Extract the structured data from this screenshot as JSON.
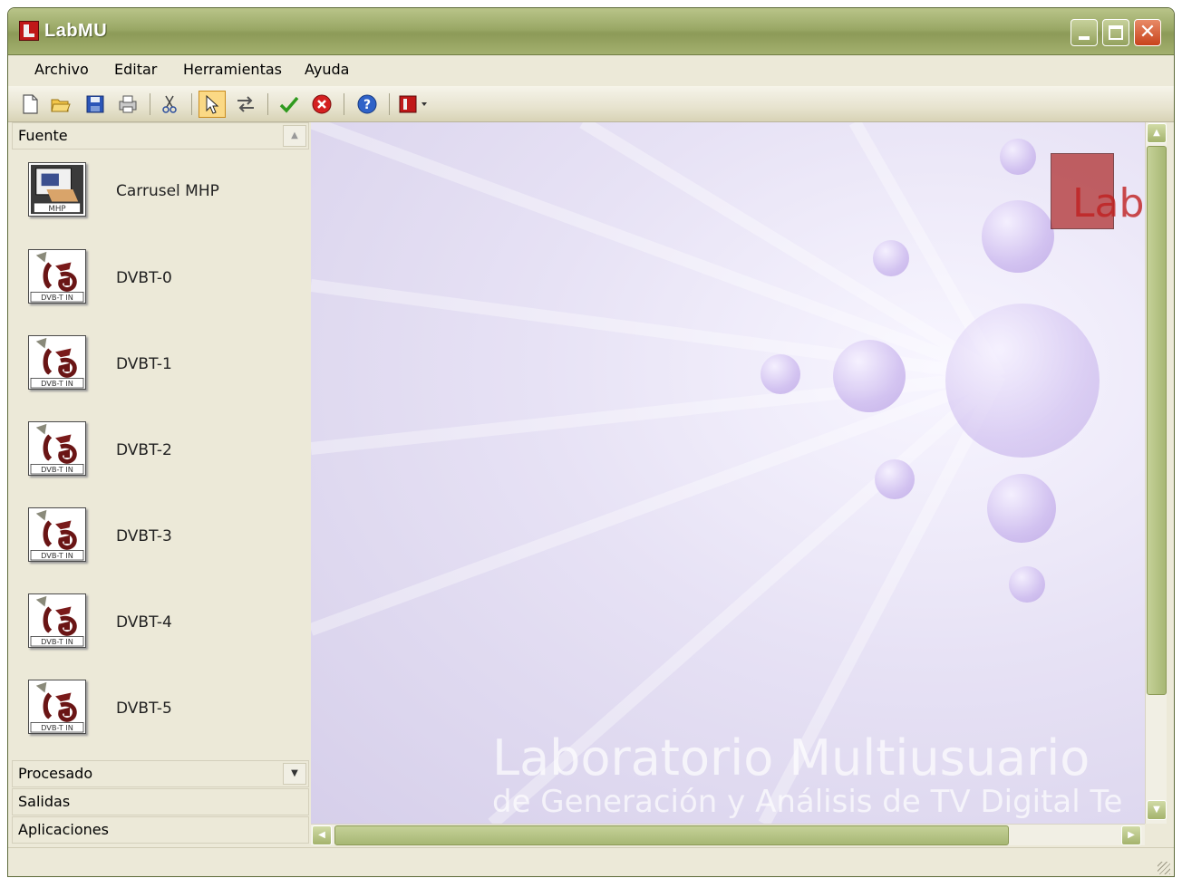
{
  "window": {
    "title": "LabMU",
    "controls": [
      "minimize",
      "maximize",
      "close"
    ]
  },
  "menu": [
    {
      "label": "Archivo"
    },
    {
      "label": "Editar"
    },
    {
      "label": "Herramientas"
    },
    {
      "label": "Ayuda"
    }
  ],
  "toolbar": {
    "icons": [
      "new-file-icon",
      "open-folder-icon",
      "save-icon",
      "print-icon",
      "cut-icon",
      "pointer-icon",
      "swap-arrows-icon",
      "checkmark-icon",
      "stop-icon",
      "help-icon",
      "app-menu-icon"
    ]
  },
  "sidebar": {
    "sections": {
      "fuente": "Fuente",
      "procesado": "Procesado",
      "salidas": "Salidas",
      "aplicaciones": "Aplicaciones"
    },
    "items": [
      {
        "label": "Carrusel MHP",
        "icon_text": "MHP"
      },
      {
        "label": "DVBT-0",
        "icon_text": "DVB-T IN"
      },
      {
        "label": "DVBT-1",
        "icon_text": "DVB-T IN"
      },
      {
        "label": "DVBT-2",
        "icon_text": "DVB-T IN"
      },
      {
        "label": "DVBT-3",
        "icon_text": "DVB-T IN"
      },
      {
        "label": "DVBT-4",
        "icon_text": "DVB-T IN"
      },
      {
        "label": "DVBT-5",
        "icon_text": "DVB-T IN"
      }
    ]
  },
  "canvas": {
    "watermark_line1": "Laboratorio Multiusuario",
    "watermark_line2": "de Generación y Análisis de TV Digital Te",
    "logo_text": "Lab"
  },
  "colors": {
    "titlebar": "#9aa866",
    "accent_red": "#c01818",
    "canvas_lavender": "#e7e2f5"
  }
}
